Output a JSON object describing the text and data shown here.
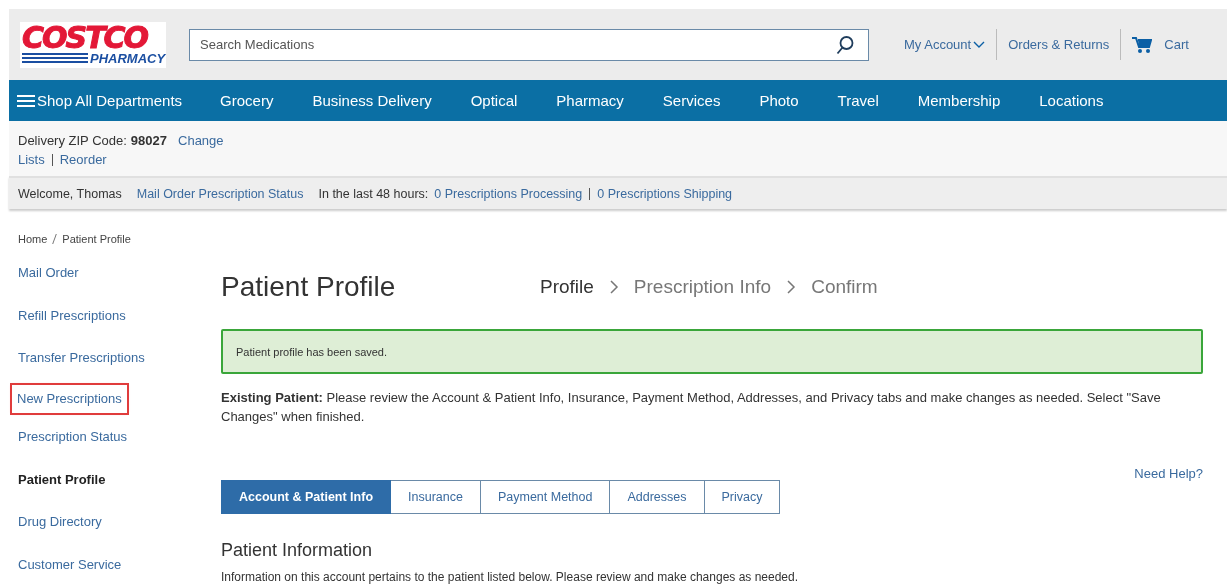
{
  "header": {
    "logo": {
      "brand": "COSTCO",
      "sub": "PHARMACY"
    },
    "search": {
      "placeholder": "Search Medications"
    },
    "account_links": [
      {
        "label": "My Account",
        "kind": "dropdown"
      },
      {
        "label": "Orders & Returns",
        "kind": "link"
      },
      {
        "label": "Cart",
        "kind": "cart"
      }
    ]
  },
  "nav": {
    "menu": "Shop All Departments",
    "items": [
      "Grocery",
      "Business Delivery",
      "Optical",
      "Pharmacy",
      "Services",
      "Photo",
      "Travel",
      "Membership",
      "Locations"
    ]
  },
  "delivery": {
    "label": "Delivery ZIP Code:",
    "zip": "98027",
    "change": "Change",
    "links": [
      "Lists",
      "Reorder"
    ]
  },
  "status_bar": {
    "welcome": "Welcome, Thomas",
    "link": "Mail Order Prescription Status",
    "prefix": "In the last 48 hours:",
    "counts": [
      "0 Prescriptions Processing",
      "0 Prescriptions Shipping"
    ]
  },
  "breadcrumb": [
    "Home",
    "Patient Profile"
  ],
  "sidebar": {
    "items": [
      {
        "label": "Mail Order",
        "selected": false,
        "highlighted": false
      },
      {
        "label": "Refill Prescriptions",
        "selected": false,
        "highlighted": false
      },
      {
        "label": "Transfer Prescriptions",
        "selected": false,
        "highlighted": false
      },
      {
        "label": "New Prescriptions",
        "selected": false,
        "highlighted": true
      },
      {
        "label": "Prescription Status",
        "selected": false,
        "highlighted": false
      },
      {
        "label": "Patient Profile",
        "selected": true,
        "highlighted": false
      },
      {
        "label": "Drug Directory",
        "selected": false,
        "highlighted": false
      },
      {
        "label": "Customer Service",
        "selected": false,
        "highlighted": false
      }
    ]
  },
  "main": {
    "title": "Patient Profile",
    "steps": [
      {
        "label": "Profile",
        "selected": true
      },
      {
        "label": "Prescription Info",
        "selected": false
      },
      {
        "label": "Confirm",
        "selected": false
      }
    ],
    "alert": "Patient profile has been saved.",
    "intro": "**Existing Patient:** Please review the Account & Patient Info, Insurance, Payment Method, Addresses, and Privacy tabs and make changes as needed. Select \"Save Changes\" when finished.",
    "help": "Need Help?",
    "tabs": [
      {
        "label": "Account & Patient Info",
        "selected": true
      },
      {
        "label": "Insurance",
        "selected": false
      },
      {
        "label": "Payment Method",
        "selected": false
      },
      {
        "label": "Addresses",
        "selected": false
      },
      {
        "label": "Privacy",
        "selected": false
      }
    ],
    "section_title": "Patient Information",
    "section_text": "Information on this account pertains to the patient listed below. Please review and make changes as needed."
  }
}
